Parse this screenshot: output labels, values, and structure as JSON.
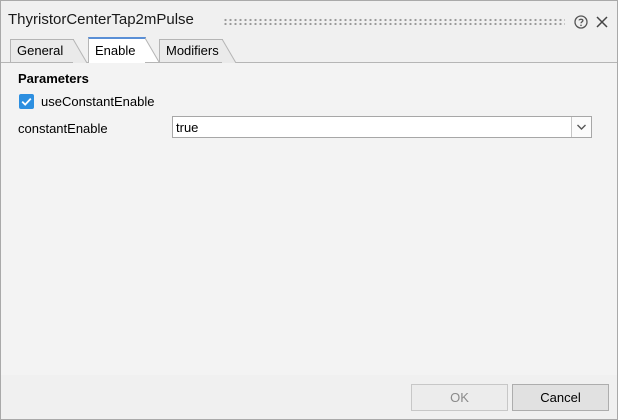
{
  "window": {
    "title": "ThyristorCenterTap2mPulse"
  },
  "tabs": [
    {
      "label": "General",
      "active": false
    },
    {
      "label": "Enable",
      "active": true
    },
    {
      "label": "Modifiers",
      "active": false
    }
  ],
  "parameters": {
    "section_title": "Parameters",
    "use_constant_enable": {
      "label": "useConstantEnable",
      "checked": true
    },
    "constant_enable": {
      "label": "constantEnable",
      "value": "true"
    }
  },
  "footer": {
    "ok_label": "OK",
    "cancel_label": "Cancel"
  },
  "colors": {
    "accent": "#2d8fe0",
    "tab_active_border": "#5a8fd6"
  },
  "icons": {
    "help": "help-icon",
    "close": "close-icon",
    "check": "check-icon",
    "dropdown": "chevron-down-icon"
  }
}
